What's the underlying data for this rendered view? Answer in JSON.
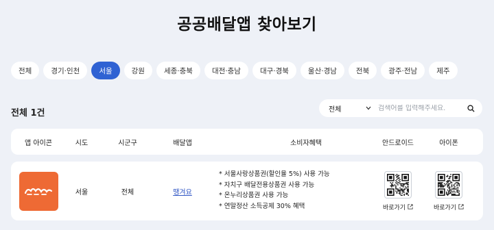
{
  "page": {
    "title": "공공배달앱 찾아보기"
  },
  "regions": [
    {
      "label": "전체",
      "active": false
    },
    {
      "label": "경기·인천",
      "active": false
    },
    {
      "label": "서울",
      "active": true
    },
    {
      "label": "강원",
      "active": false
    },
    {
      "label": "세종·충북",
      "active": false
    },
    {
      "label": "대전·충남",
      "active": false
    },
    {
      "label": "대구·경북",
      "active": false
    },
    {
      "label": "울산·경남",
      "active": false
    },
    {
      "label": "전북",
      "active": false
    },
    {
      "label": "광주·전남",
      "active": false
    },
    {
      "label": "제주",
      "active": false
    }
  ],
  "results": {
    "count_label": "전체 1건"
  },
  "search": {
    "scope_value": "전체",
    "placeholder": "검색어를 입력해주세요.",
    "value": ""
  },
  "table": {
    "headers": {
      "icon": "앱 아이콘",
      "province": "시도",
      "district": "시군구",
      "app": "배달앱",
      "benefits": "소비자혜택",
      "android": "안드로이드",
      "iphone": "아이폰"
    },
    "rows": [
      {
        "icon_text": "땡겨요",
        "province": "서울",
        "district": "전체",
        "app_name": "땡겨요",
        "benefits": [
          "* 서울사랑상품권(할인율 5%) 사용 가능",
          "* 자치구 배달전용상품권 사용 가능",
          "* 온누리상품권 사용 가능",
          "* 연말정산 소득공제 30% 혜택"
        ],
        "android_link": "바로가기",
        "iphone_link": "바로가기"
      }
    ]
  },
  "colors": {
    "accent": "#2f62d3",
    "app_icon_bg": "#ee6a34",
    "background": "#eef1f7"
  }
}
